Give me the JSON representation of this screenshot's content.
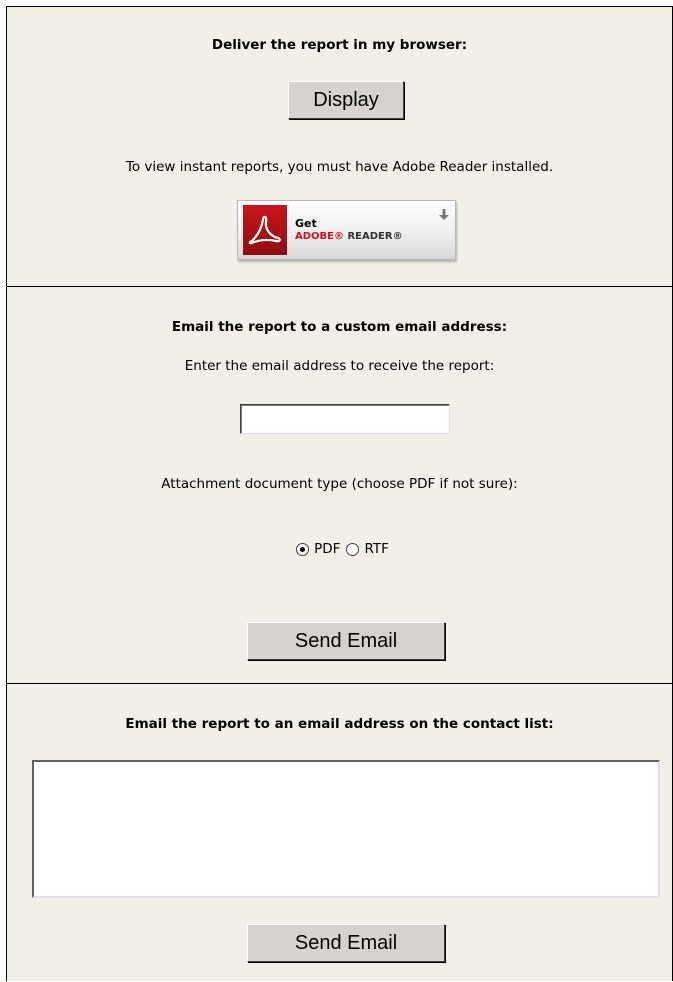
{
  "browser_section": {
    "heading": "Deliver the report in my browser:",
    "display_button": "Display",
    "note": "To view instant reports, you must have Adobe Reader installed.",
    "adobe_badge": {
      "get": "Get",
      "brand": "ADOBE®",
      "product": "READER®"
    }
  },
  "custom_email_section": {
    "heading": "Email the report to a custom email address:",
    "prompt": "Enter the email address to receive the report:",
    "email_value": "",
    "type_label": "Attachment document type (choose PDF if not sure):",
    "options": [
      {
        "label": "PDF",
        "selected": true
      },
      {
        "label": "RTF",
        "selected": false
      }
    ],
    "send_button": "Send Email"
  },
  "contact_list_section": {
    "heading": "Email the report to an email address on the contact list:",
    "send_button": "Send Email"
  },
  "colors": {
    "panel_background": "#f2efe9",
    "button_face": "#d6d3ce",
    "adobe_red": "#c8171c"
  }
}
